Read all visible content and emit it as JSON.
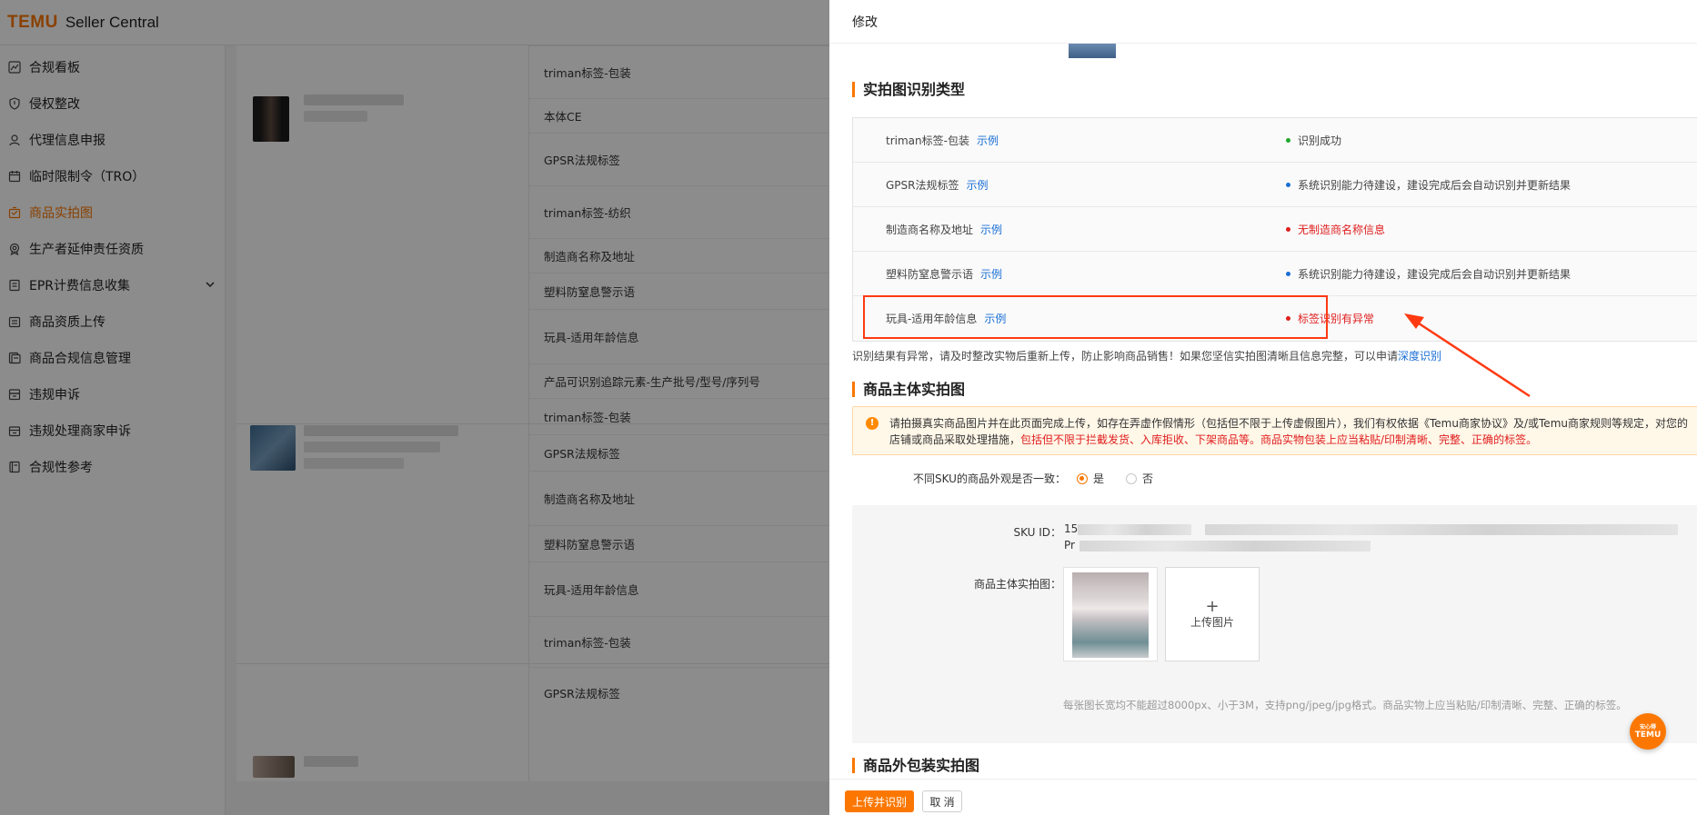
{
  "app": {
    "brand": "TEMU",
    "brand_sub": "Seller Central",
    "accent_color": "#fb7701"
  },
  "sidebar": {
    "items": [
      {
        "label": "合规看板",
        "icon": "chart-icon"
      },
      {
        "label": "侵权整改",
        "icon": "shield-icon"
      },
      {
        "label": "代理信息申报",
        "icon": "user-icon"
      },
      {
        "label": "临时限制令（TRO）",
        "icon": "calendar-icon"
      },
      {
        "label": "商品实拍图",
        "icon": "camera-icon",
        "active": true
      },
      {
        "label": "生产者延伸责任资质",
        "icon": "badge-icon"
      },
      {
        "label": "EPR计费信息收集",
        "icon": "document-icon",
        "expandable": true
      },
      {
        "label": "商品资质上传",
        "icon": "upload-icon"
      },
      {
        "label": "商品合规信息管理",
        "icon": "file-icon"
      },
      {
        "label": "违规申诉",
        "icon": "box-icon"
      },
      {
        "label": "违规处理商家申诉",
        "icon": "store-icon"
      },
      {
        "label": "合规性参考",
        "icon": "book-icon"
      }
    ]
  },
  "background_table": {
    "cells": [
      "triman标签-包装",
      "本体CE",
      "GPSR法规标签",
      "triman标签-纺织",
      "制造商名称及地址",
      "塑料防窒息警示语",
      "玩具-适用年龄信息",
      "产品可识别追踪元素-生产批号/型号/序列号",
      "triman标签-包装",
      "GPSR法规标签",
      "制造商名称及地址",
      "塑料防窒息警示语",
      "玩具-适用年龄信息",
      "triman标签-包装",
      "GPSR法规标签"
    ]
  },
  "drawer": {
    "title": "修改",
    "section_identify": "实拍图识别类型",
    "example_link": "示例",
    "id_rows": [
      {
        "name": "triman标签-包装",
        "status": "识别成功",
        "level": "green"
      },
      {
        "name": "GPSR法规标签",
        "status": "系统识别能力待建设，建设完成后会自动识别并更新结果",
        "level": "blue"
      },
      {
        "name": "制造商名称及地址",
        "status": "无制造商名称信息",
        "level": "red"
      },
      {
        "name": "塑料防窒息警示语",
        "status": "系统识别能力待建设，建设完成后会自动识别并更新结果",
        "level": "blue"
      },
      {
        "name": "玩具-适用年龄信息",
        "status": "标签识别有异常",
        "level": "red"
      }
    ],
    "note_text": "识别结果有异常，请及时整改实物后重新上传，防止影响商品销售！如果您坚信实拍图清晰且信息完整，可以申请",
    "note_link": "深度识别",
    "section_main": "商品主体实拍图",
    "warning_line1": "请拍摄真实商品图片并在此页面完成上传，如存在弄虚作假情形（包括但不限于上传虚假图片），我们有权依据《Temu商家协议》及/或Temu商家规则等规定，对您的",
    "warning_line2a": "店铺或商品采取处理措施，",
    "warning_line2b": "包括但不限于拦截发货、入库拒收、下架商品等。商品实物包装上应当粘贴/印制清晰、完整、正确的标签。",
    "sku_question": "不同SKU的商品外观是否一致：",
    "radio_yes": "是",
    "radio_no": "否",
    "sku_id_label": "SKU ID：",
    "sku_id_prefix": "15",
    "sku_pr_prefix": "Pr",
    "main_photo_label": "商品主体实拍图：",
    "upload_label": "上传图片",
    "upload_plus": "+",
    "hint": "每张图长宽均不能超过8000px、小于3M，支持png/jpeg/jpg格式。商品实物上应当粘贴/印制清晰、完整、正确的标签。",
    "section_package": "商品外包装实拍图",
    "btn_submit": "上传并识别",
    "btn_cancel": "取 消"
  },
  "float_badge": {
    "top": "安心得",
    "bottom": "TEMU"
  },
  "colors": {
    "highlight_border": "#ff3a12",
    "link": "#1a6fd6",
    "error": "#e01e1e",
    "success": "#1fa82a"
  }
}
